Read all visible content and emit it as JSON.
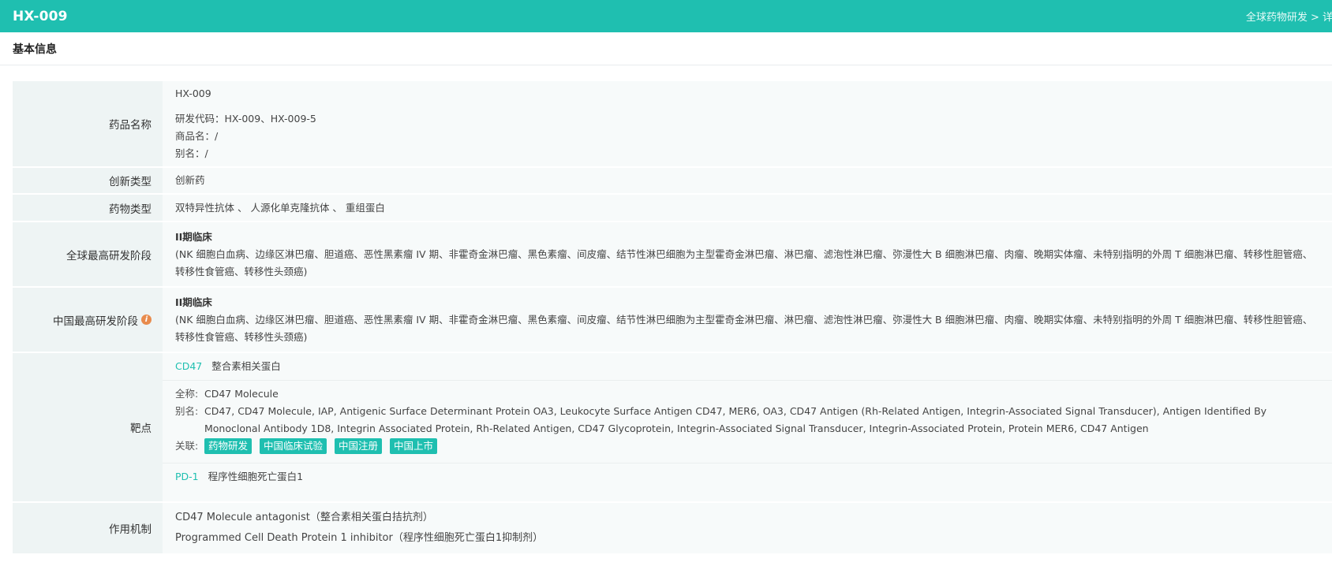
{
  "header": {
    "title": "HX-009",
    "breadcrumb": "全球药物研发 > 详情"
  },
  "section": {
    "title": "基本信息"
  },
  "rows": {
    "drug_name": {
      "label": "药品名称",
      "name": "HX-009",
      "codes": "研发代码：HX-009、HX-009-5",
      "trade_name": "商品名：/",
      "alias": "别名：/"
    },
    "innovation_type": {
      "label": "创新类型",
      "value": "创新药"
    },
    "drug_type": {
      "label": "药物类型",
      "value": "双特异性抗体 、 人源化单克隆抗体 、 重组蛋白"
    },
    "global_stage": {
      "label": "全球最高研发阶段",
      "stage": "II期临床",
      "indications": "(NK 细胞白血病、边缘区淋巴瘤、胆道癌、恶性黑素瘤 IV 期、非霍奇金淋巴瘤、黑色素瘤、间皮瘤、结节性淋巴细胞为主型霍奇金淋巴瘤、淋巴瘤、滤泡性淋巴瘤、弥漫性大 B 细胞淋巴瘤、肉瘤、晚期实体瘤、未特别指明的外周 T 细胞淋巴瘤、转移性胆管癌、转移性食管癌、转移性头颈癌)"
    },
    "china_stage": {
      "label": "中国最高研发阶段",
      "info_icon": "i",
      "stage": "II期临床",
      "indications": "(NK 细胞白血病、边缘区淋巴瘤、胆道癌、恶性黑素瘤 IV 期、非霍奇金淋巴瘤、黑色素瘤、间皮瘤、结节性淋巴细胞为主型霍奇金淋巴瘤、淋巴瘤、滤泡性淋巴瘤、弥漫性大 B 细胞淋巴瘤、肉瘤、晚期实体瘤、未特别指明的外周 T 细胞淋巴瘤、转移性胆管癌、转移性食管癌、转移性头颈癌)"
    },
    "target": {
      "label": "靶点",
      "cd47": {
        "code": "CD47",
        "name": "整合素相关蛋白",
        "full_name_key": "全称:",
        "full_name": "CD47 Molecule",
        "alias_key": "别名:",
        "alias": "CD47, CD47 Molecule, IAP, Antigenic Surface Determinant Protein OA3, Leukocyte Surface Antigen CD47, MER6, OA3, CD47 Antigen (Rh-Related Antigen, Integrin-Associated Signal Transducer), Antigen Identified By Monoclonal Antibody 1D8, Integrin Associated Protein, Rh-Related Antigen, CD47 Glycoprotein, Integrin-Associated Signal Transducer, Integrin-Associated Protein, Protein MER6, CD47 Antigen",
        "related_key": "关联:",
        "tags": [
          "药物研发",
          "中国临床试验",
          "中国注册",
          "中国上市"
        ]
      },
      "pd1": {
        "code": "PD-1",
        "name": "程序性细胞死亡蛋白1"
      }
    },
    "mechanism": {
      "label": "作用机制",
      "line1": "CD47 Molecule antagonist（整合素相关蛋白拮抗剂）",
      "line2": "Programmed Cell Death Protein 1 inhibitor（程序性细胞死亡蛋白1抑制剂）"
    }
  },
  "colors": {
    "accent": "#1fbfb0",
    "info_icon": "#e88b4d"
  }
}
